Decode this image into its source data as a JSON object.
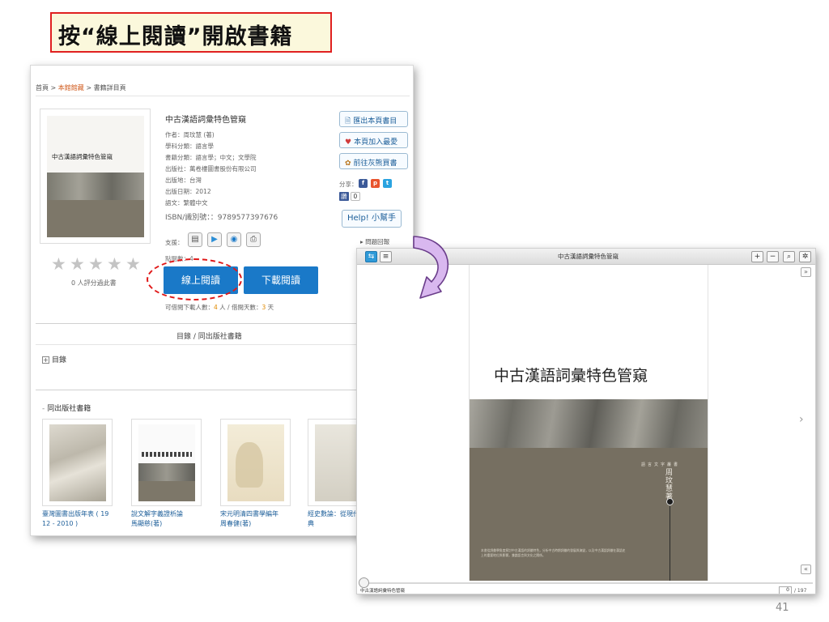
{
  "slide": {
    "title": "按“線上閱讀”開啟書籍",
    "number": "41"
  },
  "book_page": {
    "breadcrumb": {
      "home": "首頁",
      "sep1": " > ",
      "category": "本館館藏",
      "sep2": " > ",
      "current": "書籍詳目頁"
    },
    "cover_title": "中古漢語詞彙特色管窺",
    "title": "中古漢語詞彙特色管窺",
    "meta": [
      "作者：周玟慧 (著)",
      "學科分類：語言學",
      "書籍分類：語言學；中文；文學院",
      "出版社：萬卷樓圖書股份有限公司",
      "出版地：台灣",
      "出版日期：2012",
      "語文：繁體中文",
      "ISBN/識別號：：9789577397676"
    ],
    "support_label": "支援：",
    "support_icons": [
      "pc-icon",
      "android-icon",
      "ios-icon",
      "print-icon"
    ],
    "side_buttons": [
      {
        "icon": "export-icon",
        "label": "匯出本頁書目"
      },
      {
        "icon": "heart-icon",
        "label": "本頁加入最愛"
      },
      {
        "icon": "store-icon",
        "label": "前往灰熊買書"
      }
    ],
    "share_label": "分享：",
    "like_label": "讚",
    "like_count": "0",
    "help_label": "Help! 小幫手",
    "faq_label": "▸ 問題回報",
    "rating_text": "0 人評分過此書",
    "click_label": "點閱數：4",
    "read_button": "線上閱讀",
    "download_button": "下載閱讀",
    "loan_prefix": "可借閱下載人數：",
    "loan_people": "4",
    "loan_mid": " 人 / 借閱天數：",
    "loan_days": "3",
    "loan_suffix": " 天",
    "tabs_label": "目錄  /  同出版社書籍",
    "toc_label": "目錄",
    "toc_icon": "plus-box-icon",
    "publisher_label": "同出版社書籍",
    "related_books": [
      {
        "caption1": "臺灣圖書出版年表 ( 19",
        "caption2": "12 - 2010 )"
      },
      {
        "caption1": "說文解字義證析論",
        "caption2": "馬顯慈(著)"
      },
      {
        "caption1": "宋元明清四書學編年",
        "caption2": "周春健(著)"
      },
      {
        "caption1": "經史數論：從現代",
        "caption2": "典"
      }
    ]
  },
  "viewer": {
    "title": "中古漢語詞彙特色管窺",
    "page_title": "中古漢語詞彙特色管窺",
    "series": "語言文字叢書",
    "author": "周玟慧著",
    "blurb": "本書從詞彙學角度探討中古漢語的詞彙特色，分析中古時期詞彙的發展與演變，以及中古漢語詞彙在漢語史上的重要地位與影響，兼論語言與文化之關係。",
    "status_title": "中古漢語詞彙特色管窺",
    "current_page": "0",
    "total_pages": "/ 197"
  },
  "colors": {
    "title_border": "#e02020",
    "title_fill": "#fbf8dc",
    "button_blue": "#1a79c8",
    "highlight_red": "#e01818",
    "arrow_purple": "#c9a4e4"
  }
}
